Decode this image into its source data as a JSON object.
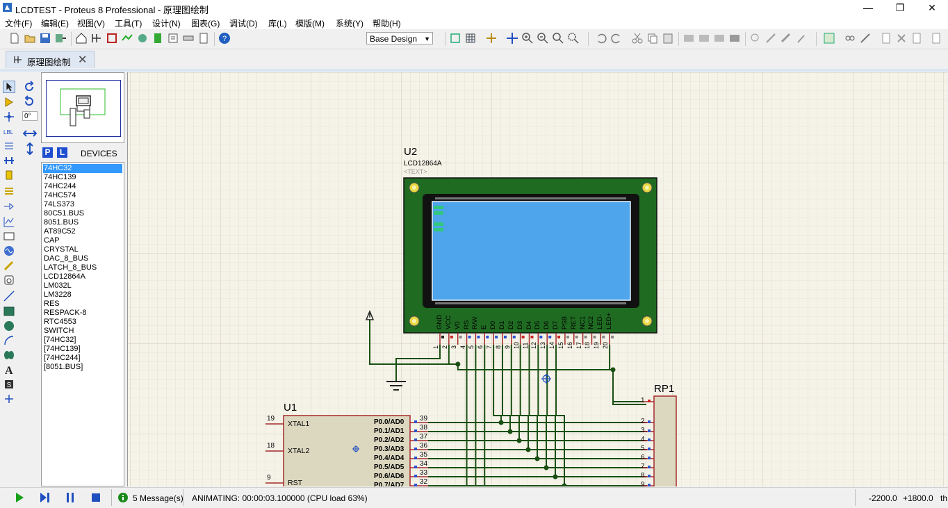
{
  "window": {
    "title": "LCDTEST - Proteus 8 Professional - 原理图绘制"
  },
  "menu": [
    "文件(F)",
    "编辑(E)",
    "视图(V)",
    "工具(T)",
    "设计(N)",
    "图表(G)",
    "调试(D)",
    "库(L)",
    "模版(M)",
    "系统(Y)",
    "帮助(H)"
  ],
  "toolbar": {
    "variant": "Base Design"
  },
  "tab": {
    "label": "原理图绘制"
  },
  "sidebar": {
    "rotation": "0°",
    "p_button": "P",
    "l_button": "L",
    "devices_label": "DEVICES",
    "devices": [
      "74HC32",
      "74HC139",
      "74HC244",
      "74HC574",
      "74LS373",
      "80C51.BUS",
      "8051.BUS",
      "AT89C52",
      "CAP",
      "CRYSTAL",
      "DAC_8_BUS",
      "LATCH_8_BUS",
      "LCD12864A",
      "LM032L",
      "LM3228",
      "RES",
      "RESPACK-8",
      "RTC4553",
      "SWITCH",
      "[74HC32]",
      "[74HC139]",
      "[74HC244]",
      "[8051.BUS]"
    ],
    "selected_device": "74HC32"
  },
  "schematic": {
    "lcd": {
      "ref": "U2",
      "part": "LCD12864A",
      "text": "<TEXT>",
      "pin_names": [
        "GND",
        "VCC",
        "V0",
        "RS",
        "R/W",
        "E",
        "D0",
        "D1",
        "D2",
        "D3",
        "D4",
        "D5",
        "D6",
        "D7",
        "PSB",
        "RET",
        "NC1",
        "NC2",
        "LED-",
        "LED+"
      ],
      "pin_numbers": [
        "1",
        "2",
        "3",
        "4",
        "5",
        "6",
        "7",
        "8",
        "9",
        "10",
        "11",
        "12",
        "13",
        "14",
        "15",
        "16",
        "17",
        "18",
        "19",
        "20"
      ]
    },
    "mcu": {
      "ref": "U1",
      "left_pins": [
        {
          "num": "19",
          "name": "XTAL1"
        },
        {
          "num": "18",
          "name": "XTAL2"
        },
        {
          "num": "9",
          "name": "RST"
        }
      ],
      "right_pins": [
        {
          "num": "39",
          "name": "P0.0/AD0"
        },
        {
          "num": "38",
          "name": "P0.1/AD1"
        },
        {
          "num": "37",
          "name": "P0.2/AD2"
        },
        {
          "num": "36",
          "name": "P0.3/AD3"
        },
        {
          "num": "35",
          "name": "P0.4/AD4"
        },
        {
          "num": "34",
          "name": "P0.5/AD5"
        },
        {
          "num": "33",
          "name": "P0.6/AD6"
        },
        {
          "num": "32",
          "name": "P0.7/AD7"
        }
      ]
    },
    "respack": {
      "ref": "RP1",
      "pins": [
        "1",
        "2",
        "3",
        "4",
        "5",
        "6",
        "7",
        "8",
        "9"
      ]
    }
  },
  "status": {
    "messages": "5 Message(s)",
    "animating": "ANIMATING: 00:00:03.100000 (CPU load 63%)",
    "x": "-2200.0",
    "y": "+1800.0",
    "unit": "th"
  },
  "colors": {
    "wire": "#1a4f12",
    "pcb": "#1f6b22",
    "lcd_screen": "#4ea5ec",
    "component_border": "#a52a2a",
    "component_fill": "#dcd8c0"
  }
}
